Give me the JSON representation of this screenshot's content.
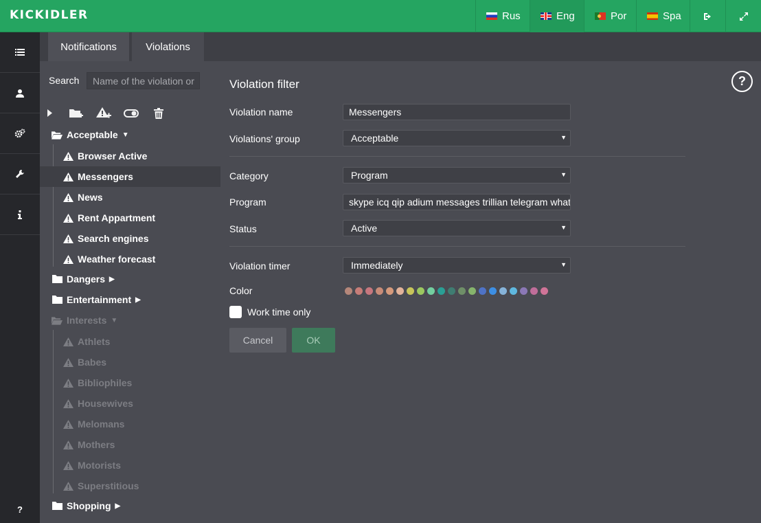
{
  "app": {
    "logo": "KICKIDLER"
  },
  "languages": [
    {
      "label": "Rus",
      "flag": "flag-ru-icon"
    },
    {
      "label": "Eng",
      "flag": "flag-gb-icon",
      "active": true
    },
    {
      "label": "Por",
      "flag": "flag-pt-icon"
    },
    {
      "label": "Spa",
      "flag": "flag-es-icon"
    }
  ],
  "header_icons": [
    "logout-icon",
    "fullscreen-icon"
  ],
  "sidenav": {
    "items": [
      "list-icon",
      "user-icon",
      "gears-icon",
      "wrench-icon",
      "info-icon"
    ],
    "help": "?"
  },
  "tabs": [
    {
      "label": "Notifications"
    },
    {
      "label": "Violations",
      "active": true
    }
  ],
  "tree": {
    "search_label": "Search",
    "search_placeholder": "Name of the violation or",
    "toolbar_icons": [
      "expand-icon",
      "add-folder-icon",
      "add-violation-icon",
      "toggle-icon",
      "trash-icon"
    ],
    "nodes": [
      {
        "label": "Acceptable",
        "type": "group",
        "open": true
      },
      {
        "label": "Browser Active",
        "type": "leaf"
      },
      {
        "label": "Messengers",
        "type": "leaf",
        "selected": true
      },
      {
        "label": "News",
        "type": "leaf"
      },
      {
        "label": "Rent Appartment",
        "type": "leaf"
      },
      {
        "label": "Search engines",
        "type": "leaf"
      },
      {
        "label": "Weather forecast",
        "type": "leaf"
      },
      {
        "label": "Dangers",
        "type": "group"
      },
      {
        "label": "Entertainment",
        "type": "group"
      },
      {
        "label": "Interests",
        "type": "group",
        "open": true,
        "disabled": true
      },
      {
        "label": "Athlets",
        "type": "leaf",
        "disabled": true
      },
      {
        "label": "Babes",
        "type": "leaf",
        "disabled": true
      },
      {
        "label": "Bibliophiles",
        "type": "leaf",
        "disabled": true
      },
      {
        "label": "Housewives",
        "type": "leaf",
        "disabled": true
      },
      {
        "label": "Melomans",
        "type": "leaf",
        "disabled": true
      },
      {
        "label": "Mothers",
        "type": "leaf",
        "disabled": true
      },
      {
        "label": "Motorists",
        "type": "leaf",
        "disabled": true
      },
      {
        "label": "Superstitious",
        "type": "leaf",
        "disabled": true
      },
      {
        "label": "Shopping",
        "type": "group"
      }
    ]
  },
  "form": {
    "title": "Violation filter",
    "name_label": "Violation name",
    "name_value": "Messengers",
    "group_label": "Violations' group",
    "group_value": "Acceptable",
    "category_label": "Category",
    "category_value": "Program",
    "program_label": "Program",
    "program_value": "skype icq qip adium messages trillian telegram whats",
    "status_label": "Status",
    "status_value": "Active",
    "timer_label": "Violation timer",
    "timer_value": "Immediately",
    "color_label": "Color",
    "colors": [
      "#b5877a",
      "#c77d78",
      "#c7777e",
      "#c98c78",
      "#d69a7c",
      "#e3b39a",
      "#c8c55a",
      "#9cc860",
      "#73cfa0",
      "#2a9f95",
      "#3f7d72",
      "#6f8f68",
      "#86b46c",
      "#4f73c6",
      "#3d8fe4",
      "#86b3d9",
      "#5fb8df",
      "#8b78b6",
      "#c06e9a",
      "#d07498"
    ],
    "work_time_label": "Work time only",
    "work_time_checked": false,
    "cancel_label": "Cancel",
    "ok_label": "OK"
  },
  "help_label": "?"
}
